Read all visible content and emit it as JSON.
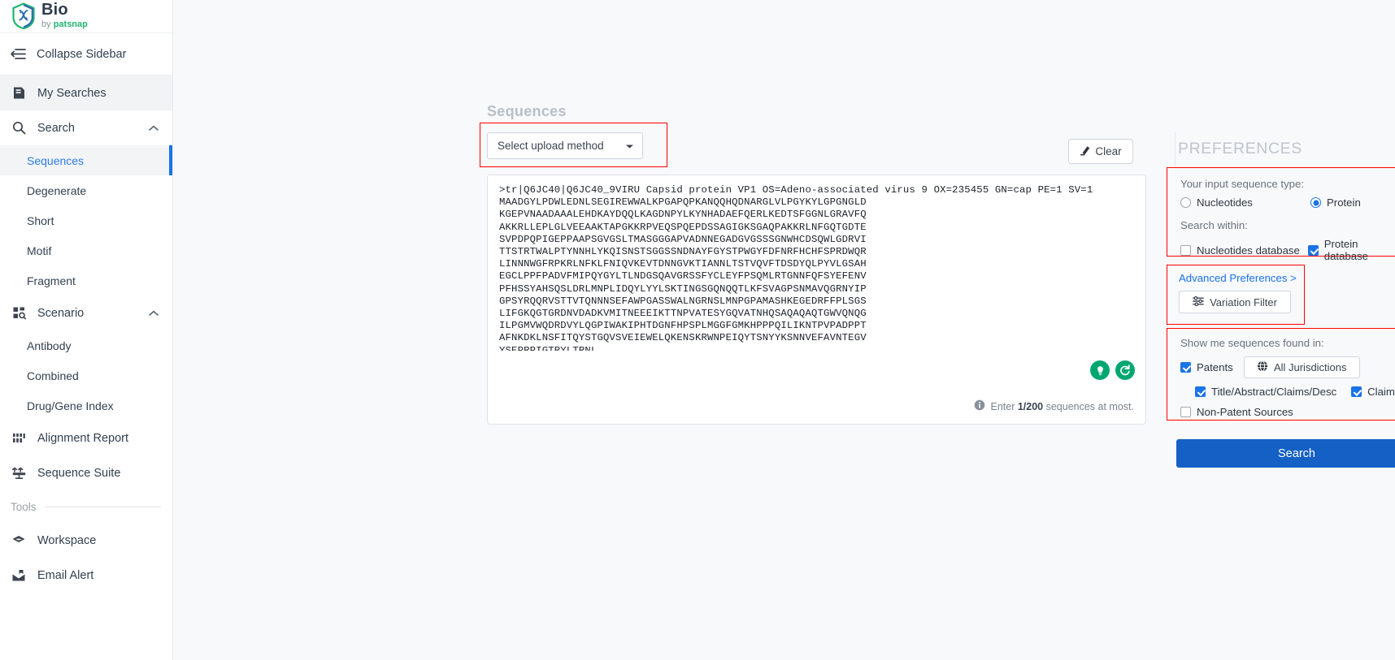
{
  "brand": {
    "name": "Bio",
    "by": "by ",
    "company": "patsnap"
  },
  "sidebar": {
    "collapse_label": "Collapse Sidebar",
    "items": [
      {
        "label": "My Searches",
        "icon": "document-icon"
      },
      {
        "label": "Search",
        "icon": "search-icon",
        "chevron": "chevron-up-icon"
      }
    ],
    "search_children": [
      {
        "label": "Sequences",
        "selected": true
      },
      {
        "label": "Degenerate",
        "selected": false
      },
      {
        "label": "Short",
        "selected": false
      },
      {
        "label": "Motif",
        "selected": false
      },
      {
        "label": "Fragment",
        "selected": false
      }
    ],
    "scenario": {
      "label": "Scenario",
      "icon": "grid-search-icon",
      "chevron": "chevron-up-icon"
    },
    "scenario_children": [
      {
        "label": "Antibody"
      },
      {
        "label": "Combined"
      },
      {
        "label": "Drug/Gene Index"
      }
    ],
    "alignment_report": {
      "label": "Alignment Report",
      "icon": "bars-icon"
    },
    "sequence_suite": {
      "label": "Sequence Suite",
      "icon": "suite-icon"
    },
    "tools_header": "Tools",
    "tools": [
      {
        "label": "Workspace",
        "icon": "workspace-icon"
      },
      {
        "label": "Email Alert",
        "icon": "email-alert-icon"
      }
    ]
  },
  "main": {
    "page_title": "Sequences",
    "upload_method": "Select upload method",
    "clear_label": "Clear",
    "hint_prefix": "Enter ",
    "hint_count": "1/200",
    "hint_suffix": " sequences at most.",
    "sequence_text": ">tr|Q6JC40|Q6JC40_9VIRU Capsid protein VP1 OS=Adeno-associated virus 9 OX=235455 GN=cap PE=1 SV=1\nMAADGYLPDWLEDNLSEGIREWWALKPGAPQPKANQQHQDNARGLVLPGYKYLGPGNGLD\nKGEPVNAADAAALEHDKAYDQQLKAGDNPYLKYNHADAEFQERLKEDTSFGGNLGRAVFQ\nAKKRLLEPLGLVEEAAKTAPGKKRPVEQSPQEPDSSAGIGKSGAQPAKKRLNFGQTGDTE\nSVPDPQPIGEPPAAPSGVGSLTMASGGGAPVADNNEGADGVGSSSGNWHCDSQWLGDRVI\nTTSTRTWALPTYNNHLYKQISNSTSGGSSNDNAYFGYSTPWGYFDFNRFHCHFSPRDWQR\nLINNNWGFRPKRLNFKLFNIQVKEVTDNNGVKTIANNLTSTVQVFTDSDYQLPYVLGSAH\nEGCLPPFPADVFMIPQYGYLTLNDGSQAVGRSSFYCLEYFPSQMLRTGNNFQFSYEFENV\nPFHSSYAHSQSLDRLMNPLIDQYLYYLSKTINGSGQNQQTLKFSVAGPSNMAVQGRNYIP\nGPSYRQQRVSTTVTQNNNSEFAWPGASSWALNGRNSLMNPGPAMASHKEGEDRFFPLSGS\nLIFGKQGTGRDNVDADKVMITNEEEIKTTNPVATESYGQVATNHQSAQAQAQTGWVQNQG\nILPGMVWQDRDVYLQGPIWAKIPHTDGNFHPSPLMGGFGMKHPPPQILIKNTPVPADPPT\nAFNKDKLNSFITQYSTGQVSVEIEWELQKENSKRWNPEIQYTSNYYKSNNVEFAVNTEGV\nYSEPRPIGTRYLTRNL"
  },
  "preferences": {
    "title": "PREFERENCES",
    "input_type_label": "Your input sequence type:",
    "input_types": [
      {
        "label": "Nucleotides",
        "selected": false
      },
      {
        "label": "Protein",
        "selected": true
      }
    ],
    "search_within_label": "Search within:",
    "search_within": [
      {
        "label": "Nucleotides database",
        "checked": false
      },
      {
        "label": "Protein database",
        "checked": true
      }
    ],
    "advanced_link": "Advanced Preferences >",
    "variation_filter": "Variation Filter",
    "found_in_label": "Show me sequences found in:",
    "patents": {
      "label": "Patents",
      "checked": true
    },
    "jurisdictions": "All Jurisdictions",
    "title_abstract": {
      "label": "Title/Abstract/Claims/Desc",
      "checked": true
    },
    "claims": {
      "label": "Claims",
      "checked": true
    },
    "non_patent": {
      "label": "Non-Patent Sources",
      "checked": false
    },
    "search_button": "Search"
  },
  "colors": {
    "accent": "#1a73e8",
    "primary_button": "#1560c4",
    "highlight_box": "#ff0000",
    "green": "#00a76f",
    "brand_green": "#22b573"
  }
}
